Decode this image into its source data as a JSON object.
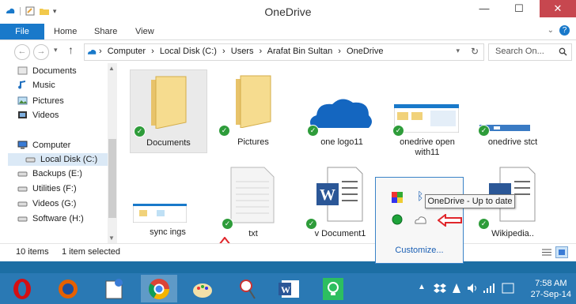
{
  "window": {
    "title": "OneDrive",
    "controls": {
      "minimize": "—",
      "maximize": "☐",
      "close": "✕"
    }
  },
  "ribbon": {
    "tabs": [
      {
        "label": "File"
      },
      {
        "label": "Home"
      },
      {
        "label": "Share"
      },
      {
        "label": "View"
      }
    ]
  },
  "address": {
    "crumbs": [
      "Computer",
      "Local Disk (C:)",
      "Users",
      "Arafat Bin Sultan",
      "OneDrive"
    ],
    "search_placeholder": "Search On..."
  },
  "nav": {
    "items": [
      {
        "label": "Documents"
      },
      {
        "label": "Music"
      },
      {
        "label": "Pictures"
      },
      {
        "label": "Videos"
      },
      {
        "label": "Computer"
      },
      {
        "label": "Local Disk (C:)"
      },
      {
        "label": "Backups (E:)"
      },
      {
        "label": "Utilities (F:)"
      },
      {
        "label": "Videos (G:)"
      },
      {
        "label": "Software (H:)"
      }
    ]
  },
  "files": [
    {
      "label": "Documents"
    },
    {
      "label": "Pictures"
    },
    {
      "label": "one logo11"
    },
    {
      "label": "onedrive open with11"
    },
    {
      "label": "onedrive stct"
    },
    {
      "label": "sync ings"
    },
    {
      "label": "txt"
    },
    {
      "label": "v Document1"
    },
    {
      "label": "Wikipedia.."
    }
  ],
  "status": {
    "count": "10 items",
    "selected": "1 item selected"
  },
  "tray_popup": {
    "tooltip": "OneDrive - Up to date",
    "customize": "Customize..."
  },
  "clock": {
    "time": "7:58 AM",
    "date": "27-Sep-14"
  },
  "colors": {
    "accent": "#1979ca",
    "taskbar": "#2a79b4",
    "sync_ok": "#2e9c3a",
    "arrow": "#e0262b"
  }
}
